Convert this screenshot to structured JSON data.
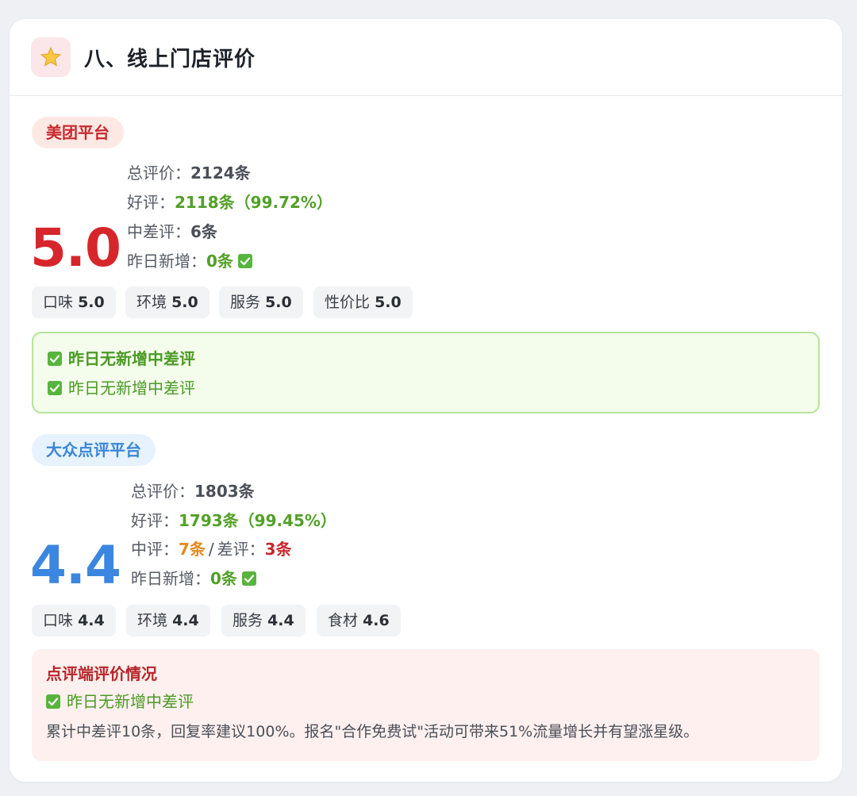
{
  "section": {
    "title": "八、线上门店评价",
    "icon": "star-icon"
  },
  "meituan": {
    "tag": "美团平台",
    "score": "5.0",
    "total_label": "总评价：",
    "total_value": "2124条",
    "good_label": "好评：",
    "good_value": "2118条（99.72%）",
    "midbad_label": "中差评：",
    "midbad_value": "6条",
    "new_label": "昨日新增：",
    "new_value": "0条",
    "chips": [
      {
        "label": "口味",
        "value": "5.0"
      },
      {
        "label": "环境",
        "value": "5.0"
      },
      {
        "label": "服务",
        "value": "5.0"
      },
      {
        "label": "性价比",
        "value": "5.0"
      }
    ],
    "notice": {
      "line1": "昨日无新增中差评",
      "line2": "昨日无新增中差评"
    }
  },
  "dianping": {
    "tag": "大众点评平台",
    "score": "4.4",
    "total_label": "总评价：",
    "total_value": "1803条",
    "good_label": "好评：",
    "good_value": "1793条（99.45%）",
    "mid_label": "中评：",
    "mid_value": "7条",
    "slash": "/",
    "bad_label": "差评：",
    "bad_value": "3条",
    "new_label": "昨日新增：",
    "new_value": "0条",
    "chips": [
      {
        "label": "口味",
        "value": "4.4"
      },
      {
        "label": "环境",
        "value": "4.4"
      },
      {
        "label": "服务",
        "value": "4.4"
      },
      {
        "label": "食材",
        "value": "4.6"
      }
    ],
    "notice": {
      "title": "点评端评价情况",
      "line1": "昨日无新增中差评",
      "text": "累计中差评10条，回复率建议100%。报名\"合作免费试\"活动可带来51%流量增长并有望涨星级。"
    }
  },
  "colors": {
    "meituan_red": "#d6262b",
    "dianping_blue": "#3b86e0",
    "good_green": "#52a028",
    "mid_orange": "#e08a23"
  }
}
